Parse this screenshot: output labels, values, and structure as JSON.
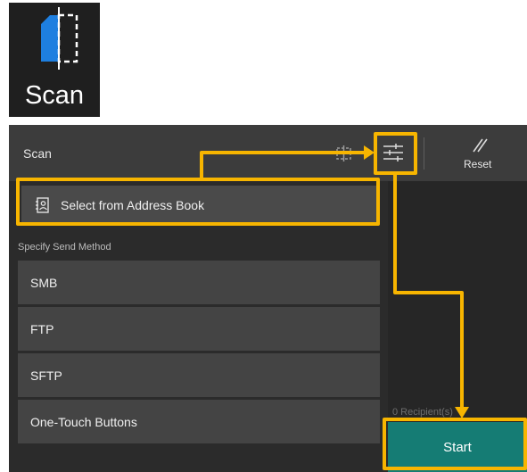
{
  "app_tile": {
    "label": "Scan",
    "icon": "scan-document-icon"
  },
  "header": {
    "title": "Scan",
    "preview_icon": "preview-icon",
    "settings_icon": "settings-sliders-icon",
    "reset_label": "Reset",
    "reset_icon": "reset-icon"
  },
  "address_book": {
    "label": "Select from Address Book",
    "icon": "address-book-icon"
  },
  "send_method": {
    "heading": "Specify Send Method",
    "items": [
      {
        "label": "SMB"
      },
      {
        "label": "FTP"
      },
      {
        "label": "SFTP"
      },
      {
        "label": "One-Touch Buttons"
      }
    ]
  },
  "recipients_text": "0 Recipient(s)",
  "start_label": "Start",
  "colors": {
    "highlight": "#f7b500",
    "start": "#157c74",
    "scan_icon_blue": "#1e7fe0"
  }
}
